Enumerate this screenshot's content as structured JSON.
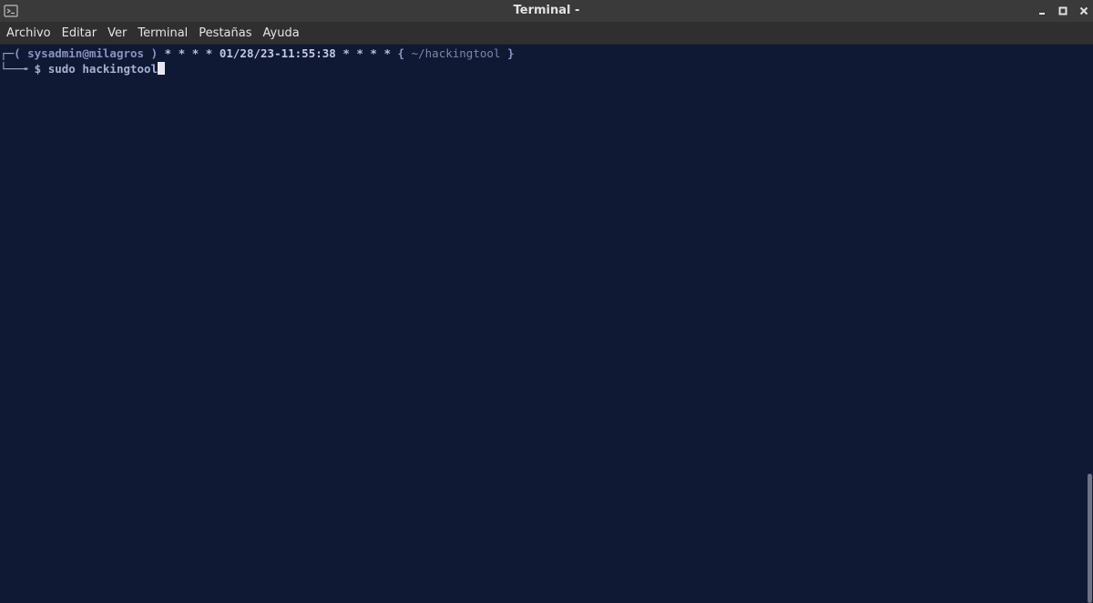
{
  "window": {
    "title": "Terminal -"
  },
  "menu": {
    "items": [
      "Archivo",
      "Editar",
      "Ver",
      "Terminal",
      "Pestañas",
      "Ayuda"
    ]
  },
  "terminal": {
    "line1": {
      "corner": "┌─",
      "open_paren": "( ",
      "user_host": "sysadmin@milagros",
      "close_paren": " )",
      "stars_left": " * * * * ",
      "datetime": "01/28/23-11:55:38",
      "stars_right": " * * * * ",
      "open_brace": "{ ",
      "path": "~/hackingtool",
      "close_brace": " }"
    },
    "line2": {
      "corner": "└──╼",
      "prompt": " $ ",
      "command": "sudo hackingtool"
    }
  },
  "colors": {
    "background": "#0f1934",
    "titlebar": "#3a3a3a",
    "menubar": "#2f2f2f",
    "text": "#a7aecd"
  },
  "icons": {
    "app": "terminal-icon",
    "minimize": "minimize-icon",
    "maximize": "maximize-icon",
    "close": "close-icon"
  }
}
